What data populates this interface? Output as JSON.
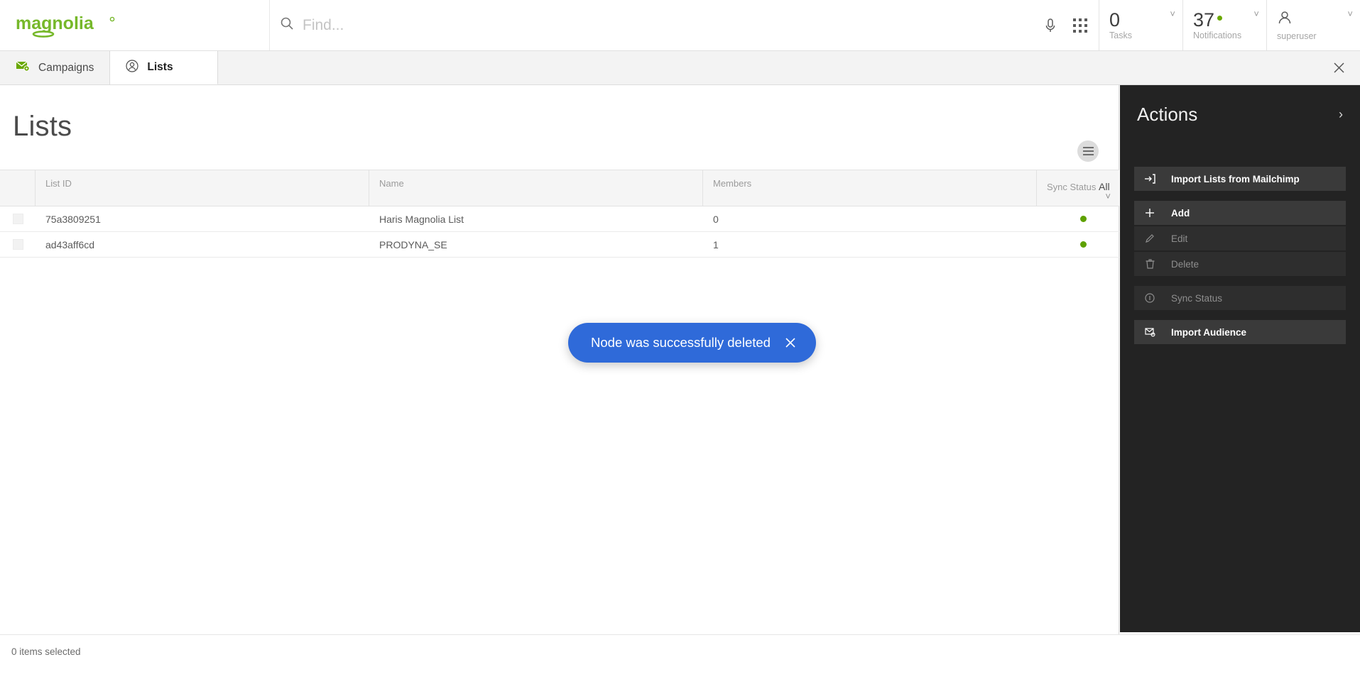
{
  "header": {
    "logo_text": "magnolia",
    "search_placeholder": "Find...",
    "search_value": "",
    "mic_icon": "microphone-icon",
    "apps_icon": "apps-grid-icon",
    "tasks": {
      "count": "0",
      "label": "Tasks"
    },
    "notifications": {
      "count": "37",
      "label": "Notifications",
      "has_alert": true,
      "alert_color": "#6aa800"
    },
    "user": {
      "name": "superuser"
    }
  },
  "tabs": [
    {
      "label": "Campaigns",
      "icon": "envelope-gear-icon",
      "active": false
    },
    {
      "label": "Lists",
      "icon": "circle-person-icon",
      "active": true
    }
  ],
  "tabbar": {
    "close_label": "✕"
  },
  "main": {
    "page_title": "Lists",
    "view_toggle_icon": "list-view-icon",
    "table": {
      "columns": [
        "List ID",
        "Name",
        "Members",
        "Sync Status"
      ],
      "sync_filter": {
        "label": "Sync Status",
        "value": "All"
      },
      "rows": [
        {
          "checked": false,
          "list_id": "75a3809251",
          "name": "Haris Magnolia List",
          "members": "0",
          "sync_color": "#5ea100"
        },
        {
          "checked": false,
          "list_id": "ad43aff6cd",
          "name": "PRODYNA_SE",
          "members": "1",
          "sync_color": "#5ea100"
        }
      ]
    }
  },
  "toast": {
    "message": "Node was successfully deleted",
    "close_label": "✕",
    "background": "#2f6ad9"
  },
  "actions": {
    "title": "Actions",
    "collapse_icon": "chevron-right-icon",
    "items": [
      {
        "label": "Import Lists from Mailchimp",
        "icon": "import-arrow-icon",
        "enabled": true
      },
      {
        "label": "Add",
        "icon": "plus-icon",
        "enabled": true
      },
      {
        "label": "Edit",
        "icon": "pencil-icon",
        "enabled": false
      },
      {
        "label": "Delete",
        "icon": "trash-icon",
        "enabled": false
      },
      {
        "label": "Sync Status",
        "icon": "info-circle-icon",
        "enabled": false
      },
      {
        "label": "Import Audience",
        "icon": "envelope-import-icon",
        "enabled": true
      }
    ]
  },
  "footer": {
    "status": "0 items selected"
  }
}
